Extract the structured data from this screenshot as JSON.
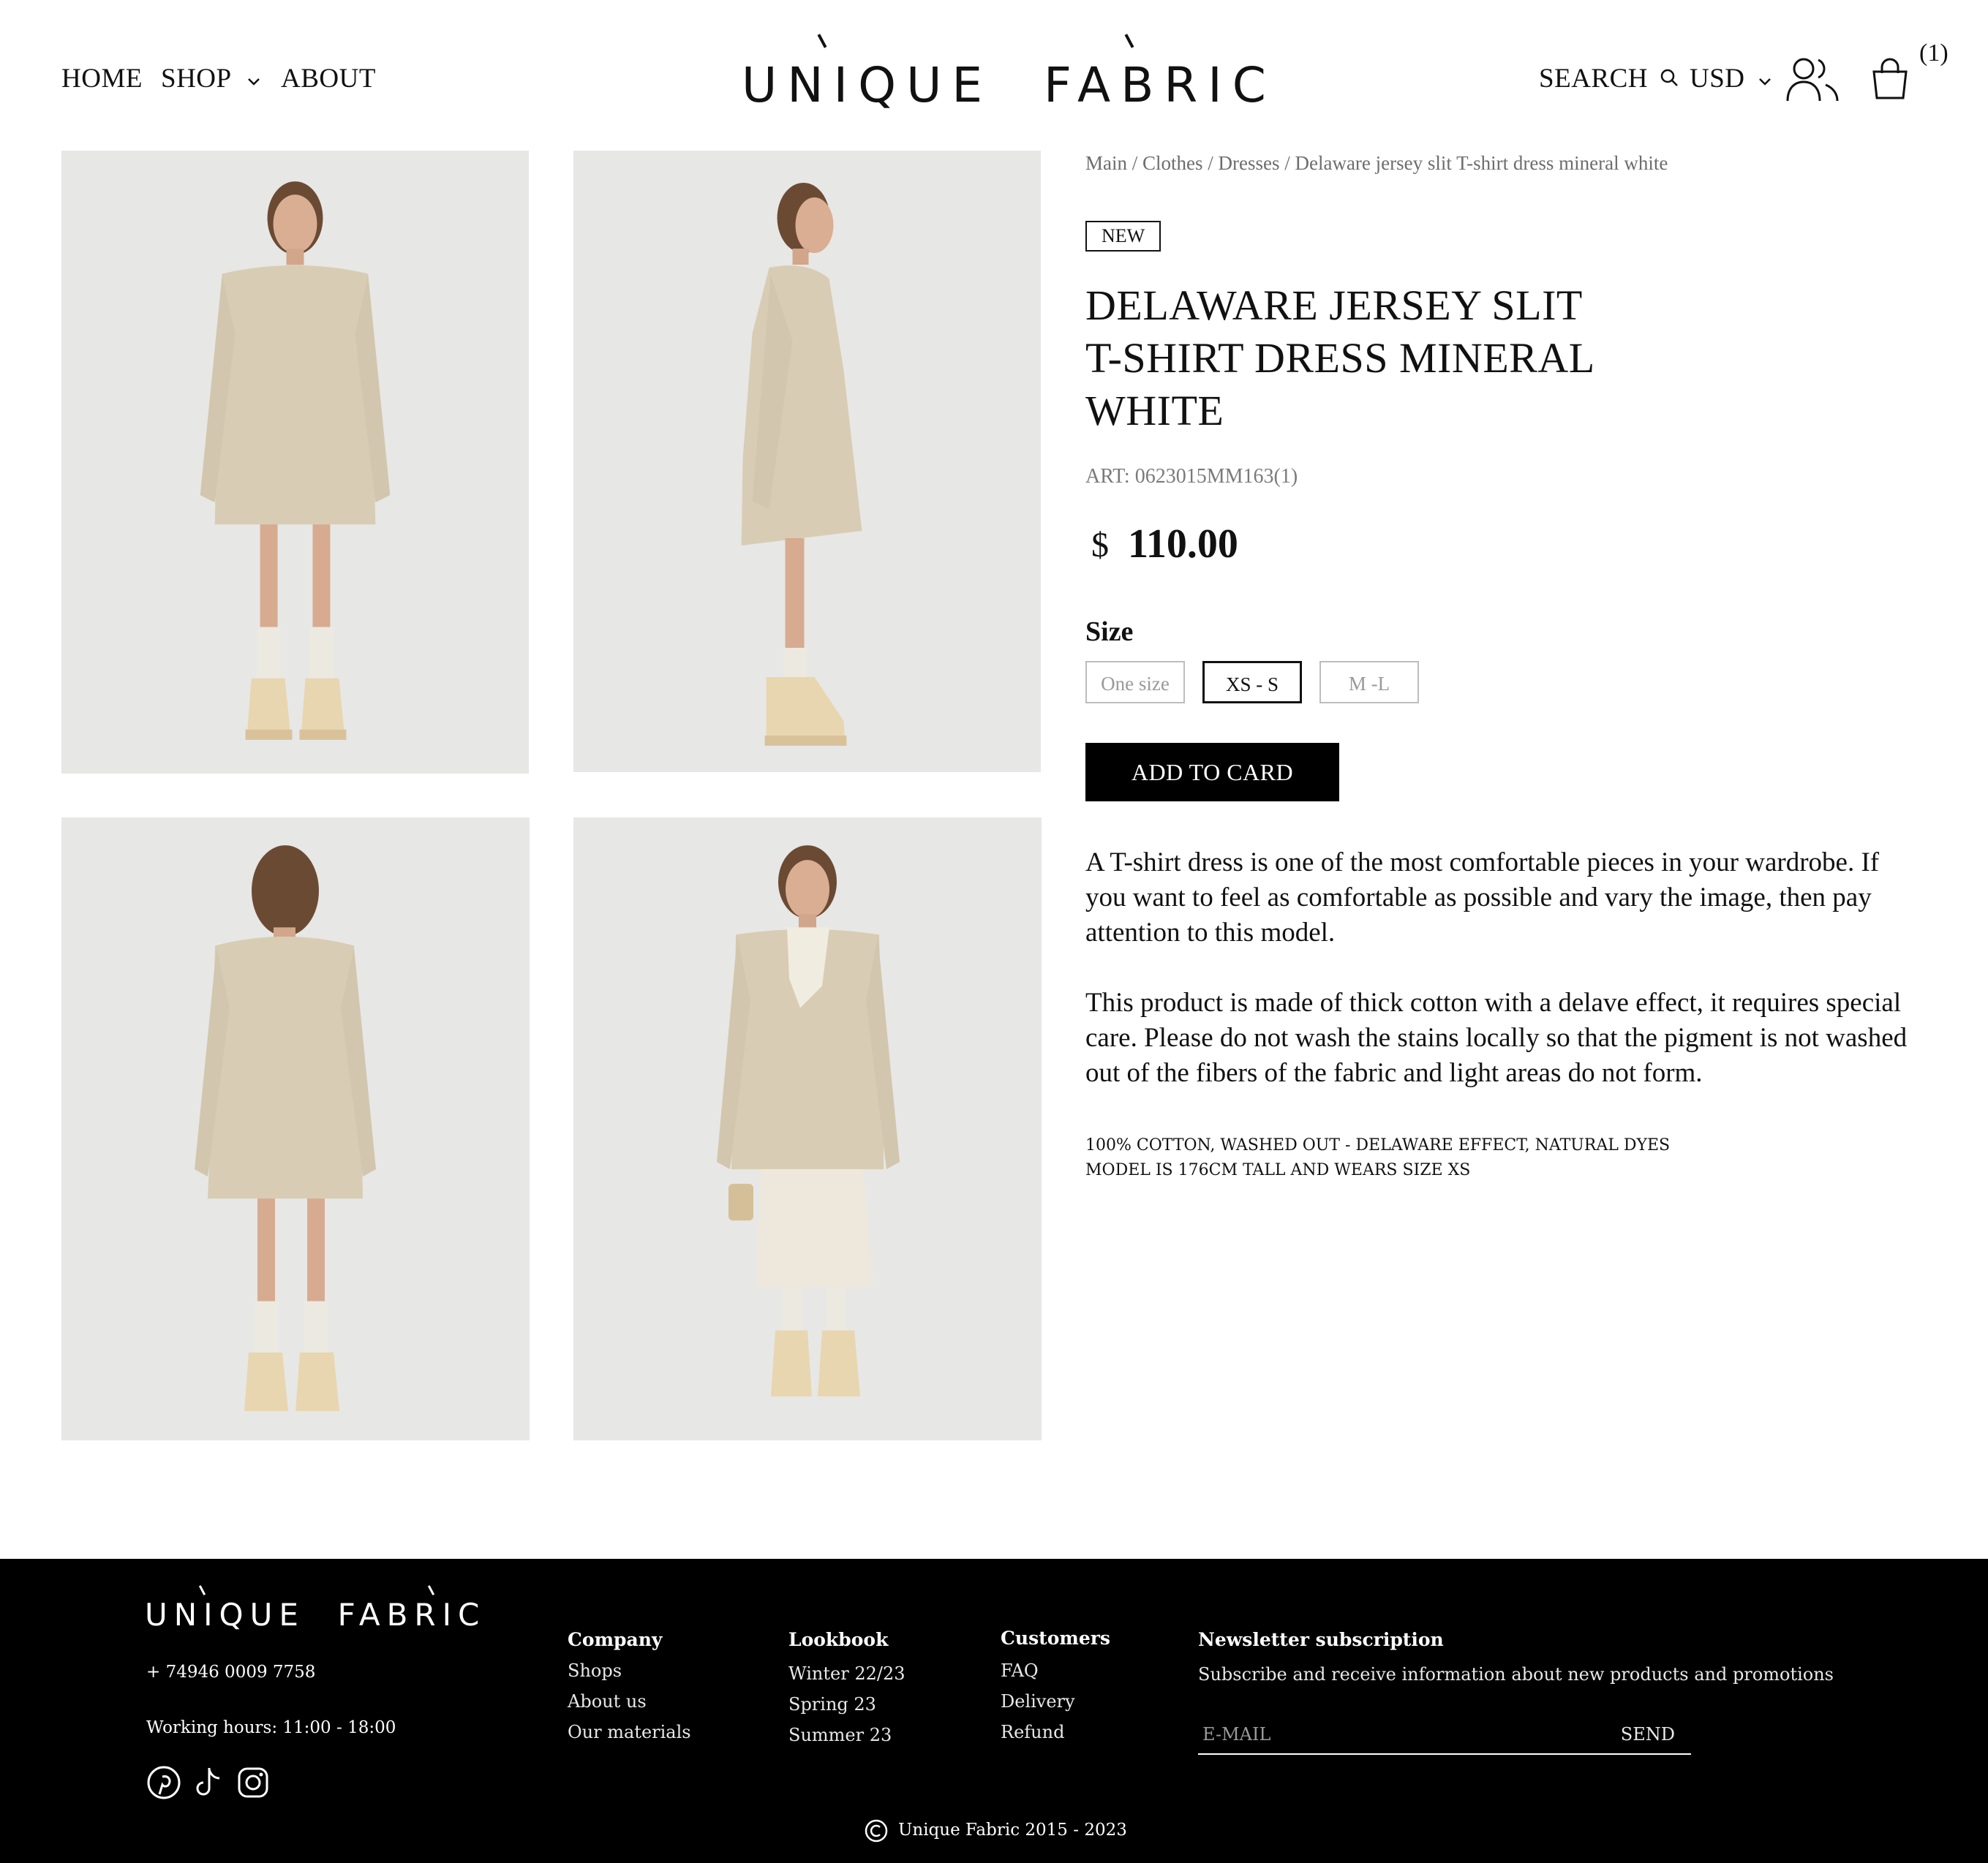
{
  "header": {
    "nav": [
      "HOME",
      "SHOP",
      "ABOUT"
    ],
    "logo": "UNIQUE  FABRIC",
    "search_label": "SEARCH",
    "currency": "USD",
    "cart_count": "(1)"
  },
  "breadcrumb": "Main / Clothes / Dresses / Delaware jersey slit T-shirt dress mineral white",
  "product": {
    "badge": "NEW",
    "title_lines": [
      "DELAWARE JERSEY SLIT",
      "T-SHIRT DRESS MINERAL",
      "WHITE"
    ],
    "art": "ART: 0623015MM163(1)",
    "currency_symbol": "$",
    "price": "110.00",
    "size_label": "Size",
    "sizes": [
      "One size",
      "XS - S",
      "M -L"
    ],
    "selected_size": "XS - S",
    "add_to_cart": "ADD TO CARD",
    "description": [
      "A T-shirt dress is one of the most comfortable pieces in your wardrobe. If you want to feel as comfortable as possible and vary the image, then pay attention to this model.",
      "This product is made of thick cotton with a delave effect, it requires special care. Please do not wash the stains locally so that the pigment is not washed out of the fibers of the fabric and light areas do not form."
    ],
    "specs": [
      "100% COTTON, WASHED OUT - DELAWARE EFFECT, NATURAL DYES",
      "MODEL IS 176CM TALL AND WEARS SIZE XS"
    ]
  },
  "gallery": {
    "photos": [
      "front-view",
      "side-view",
      "back-view",
      "styled-view"
    ]
  },
  "footer": {
    "logo": "UNIQUE  FABRIC",
    "phone": "+ 74946 0009 7758",
    "hours": "Working hours: 11:00 - 18:00",
    "social_icons": [
      "pinterest-icon",
      "tiktok-icon",
      "instagram-icon"
    ],
    "columns": [
      {
        "title": "Company",
        "links": [
          "Shops",
          "About us",
          "Our materials"
        ]
      },
      {
        "title": "Lookbook",
        "links": [
          "Winter 22/23",
          "Spring 23",
          "Summer 23"
        ]
      },
      {
        "title": "Customers",
        "links": [
          "FAQ",
          "Delivery",
          "Refund"
        ]
      }
    ],
    "newsletter": {
      "title": "Newsletter subscription",
      "text": "Subscribe and receive information about new products and promotions",
      "placeholder": "E-MAIL",
      "send": "SEND"
    },
    "copyright": "Unique Fabric 2015 - 2023"
  },
  "colors": {
    "background": "#ffffff",
    "footer": "#000000",
    "photo_bg": "#e6e6e4",
    "garment": "#d8ccb4"
  }
}
